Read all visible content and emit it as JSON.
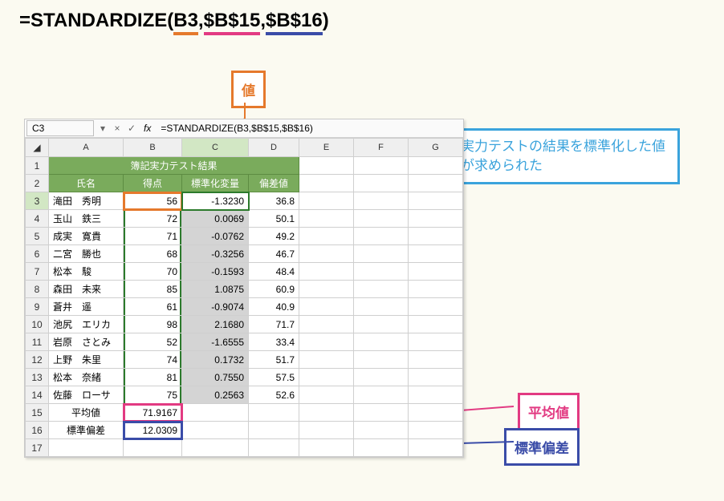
{
  "formula": {
    "prefix": "=STANDARDIZE(",
    "arg1": "B3",
    "sep1": ",",
    "arg2": "$B$15",
    "sep2": ",",
    "arg3": "$B$16",
    "suffix": ")"
  },
  "callouts": {
    "value": "値",
    "resultnote": "実力テストの結果を標準化した値が求められた",
    "mean": "平均値",
    "stddev": "標準偏差"
  },
  "cellref": "C3",
  "fx": "fx",
  "formulabar": "=STANDARDIZE(B3,$B$15,$B$16)",
  "cols": [
    "A",
    "B",
    "C",
    "D",
    "E",
    "F",
    "G"
  ],
  "header": {
    "title": "簿記実力テスト結果",
    "name": "氏名",
    "score": "得点",
    "std": "標準化変量",
    "dev": "偏差値"
  },
  "rows": [
    {
      "n": "滝田　秀明",
      "s": "56",
      "z": "-1.3230",
      "d": "36.8"
    },
    {
      "n": "玉山　鉄三",
      "s": "72",
      "z": "0.0069",
      "d": "50.1"
    },
    {
      "n": "成実　寛貴",
      "s": "71",
      "z": "-0.0762",
      "d": "49.2"
    },
    {
      "n": "二宮　勝也",
      "s": "68",
      "z": "-0.3256",
      "d": "46.7"
    },
    {
      "n": "松本　駿",
      "s": "70",
      "z": "-0.1593",
      "d": "48.4"
    },
    {
      "n": "森田　未来",
      "s": "85",
      "z": "1.0875",
      "d": "60.9"
    },
    {
      "n": "蒼井　遥",
      "s": "61",
      "z": "-0.9074",
      "d": "40.9"
    },
    {
      "n": "池尻　エリカ",
      "s": "98",
      "z": "2.1680",
      "d": "71.7"
    },
    {
      "n": "岩原　さとみ",
      "s": "52",
      "z": "-1.6555",
      "d": "33.4"
    },
    {
      "n": "上野　朱里",
      "s": "74",
      "z": "0.1732",
      "d": "51.7"
    },
    {
      "n": "松本　奈緒",
      "s": "81",
      "z": "0.7550",
      "d": "57.5"
    },
    {
      "n": "佐藤　ローサ",
      "s": "75",
      "z": "0.2563",
      "d": "52.6"
    }
  ],
  "footer": {
    "meanlabel": "平均値",
    "meanval": "71.9167",
    "sdlabel": "標準偏差",
    "sdval": "12.0309"
  },
  "glyphs": {
    "dropdown": "▾",
    "times": "×",
    "check": "✓"
  },
  "chart_data": {
    "type": "table",
    "title": "簿記実力テスト結果",
    "columns": [
      "氏名",
      "得点",
      "標準化変量",
      "偏差値"
    ],
    "rows": [
      [
        "滝田　秀明",
        56,
        -1.323,
        36.8
      ],
      [
        "玉山　鉄三",
        72,
        0.0069,
        50.1
      ],
      [
        "成実　寛貴",
        71,
        -0.0762,
        49.2
      ],
      [
        "二宮　勝也",
        68,
        -0.3256,
        46.7
      ],
      [
        "松本　駿",
        70,
        -0.1593,
        48.4
      ],
      [
        "森田　未来",
        85,
        1.0875,
        60.9
      ],
      [
        "蒼井　遥",
        61,
        -0.9074,
        40.9
      ],
      [
        "池尻　エリカ",
        98,
        2.168,
        71.7
      ],
      [
        "岩原　さとみ",
        52,
        -1.6555,
        33.4
      ],
      [
        "上野　朱里",
        74,
        0.1732,
        51.7
      ],
      [
        "松本　奈緒",
        81,
        0.755,
        57.5
      ],
      [
        "佐藤　ローサ",
        75,
        0.2563,
        52.6
      ]
    ],
    "aggregate": {
      "平均値": 71.9167,
      "標準偏差": 12.0309
    }
  }
}
